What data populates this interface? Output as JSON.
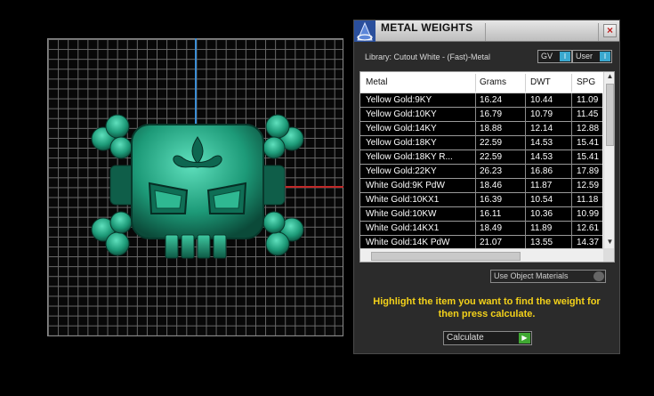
{
  "panel": {
    "title": "METAL WEIGHTS",
    "close_label": "×",
    "library_label": "Library: Cutout White - (Fast)-Metal",
    "toggle_gv": "GV",
    "toggle_user": "User",
    "toggle_knob": "I",
    "use_object_materials": "Use Object Materials",
    "hint": "Highlight the item you want to find the weight for then press calculate.",
    "calculate_label": "Calculate",
    "go_glyph": "▶"
  },
  "table": {
    "headers": [
      "Metal",
      "Grams",
      "DWT",
      "SPG"
    ],
    "rows": [
      [
        "Yellow Gold:9KY",
        "16.24",
        "10.44",
        "11.09"
      ],
      [
        "Yellow Gold:10KY",
        "16.79",
        "10.79",
        "11.45"
      ],
      [
        "Yellow Gold:14KY",
        "18.88",
        "12.14",
        "12.88"
      ],
      [
        "Yellow Gold:18KY",
        "22.59",
        "14.53",
        "15.41"
      ],
      [
        "Yellow Gold:18KY R...",
        "22.59",
        "14.53",
        "15.41"
      ],
      [
        "Yellow Gold:22KY",
        "26.23",
        "16.86",
        "17.89"
      ],
      [
        "White Gold:9K PdW",
        "18.46",
        "11.87",
        "12.59"
      ],
      [
        "White Gold:10KX1",
        "16.39",
        "10.54",
        "11.18"
      ],
      [
        "White Gold:10KW",
        "16.11",
        "10.36",
        "10.99"
      ],
      [
        "White Gold:14KX1",
        "18.49",
        "11.89",
        "12.61"
      ],
      [
        "White Gold:14K PdW",
        "21.07",
        "13.55",
        "14.37"
      ]
    ],
    "scroll_up": "▲",
    "scroll_down": "▼"
  },
  "colors": {
    "model": "#1f9c7d",
    "hint": "#f3d11a",
    "y_axis": "#3d8fd6",
    "x_axis": "#c22a2a"
  }
}
